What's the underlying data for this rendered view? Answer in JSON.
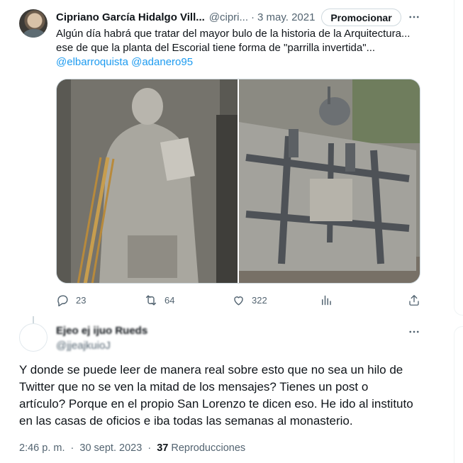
{
  "tweet": {
    "author_name": "Cipriano García Hidalgo Vill...",
    "author_handle": "@cipri...",
    "date": "3 may. 2021",
    "promote_label": "Promocionar",
    "text_lines": [
      "Algún día habrá que tratar del mayor bulo de la historia de la Arquitectura...",
      "ese de que la planta del Escorial tiene forma de \"parrilla invertida\"..."
    ],
    "mentions": "@elbarroquista @adanero95",
    "media": [
      {
        "icon": "statue-photo"
      },
      {
        "icon": "monastery-aerial-photo"
      }
    ],
    "actions": {
      "replies": "23",
      "retweets": "64",
      "likes": "322"
    }
  },
  "reply": {
    "author_name": "Ejeo ej ijuo Rueds",
    "author_handle": "@jjeajkuioJ",
    "text_lines": [
      "Y donde se puede leer de manera real sobre esto que no sea un hilo de",
      "Twitter que no se ven la mitad de los mensajes? Tienes un post o",
      "artículo? Porque en el propio San Lorenzo te dicen eso. He ido al instituto",
      "en las casas de oficios e iba todas las semanas al monasterio."
    ],
    "time": "2:46 p. m.",
    "date": "30 sept. 2023",
    "views_count": "37",
    "views_label": "Reproducciones"
  },
  "colors": {
    "text": "#0f1419",
    "secondary": "#536471",
    "link": "#1d9bf0",
    "border": "#cfd9de"
  }
}
